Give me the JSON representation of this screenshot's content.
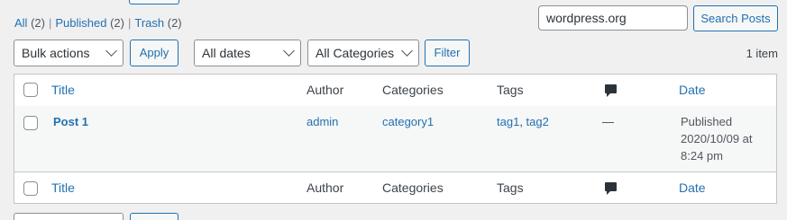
{
  "views": {
    "all_label": "All",
    "all_count": "(2)",
    "published_label": "Published",
    "published_count": "(2)",
    "trash_label": "Trash",
    "trash_count": "(2)",
    "separator": "|"
  },
  "search": {
    "value": "wordpress.org",
    "button_label": "Search Posts"
  },
  "filters": {
    "bulk_actions": "Bulk actions",
    "apply_label": "Apply",
    "dates": "All dates",
    "categories": "All Categories",
    "filter_label": "Filter"
  },
  "pagination": {
    "items": "1 item"
  },
  "table": {
    "headers": {
      "title": "Title",
      "author": "Author",
      "categories": "Categories",
      "tags": "Tags",
      "comments_icon": "comment-bubble-icon",
      "date": "Date"
    },
    "rows": [
      {
        "title": "Post 1",
        "author": "admin",
        "category": "category1",
        "tag1": "tag1",
        "tag_sep": ", ",
        "tag2": "tag2",
        "comments": "—",
        "date_status": "Published",
        "date_value": "2020/10/09 at",
        "date_time": "8:24 pm"
      }
    ]
  },
  "colors": {
    "link": "#2271b1",
    "text": "#3c434a",
    "border": "#c3c4c7",
    "background": "#f0f0f1"
  }
}
